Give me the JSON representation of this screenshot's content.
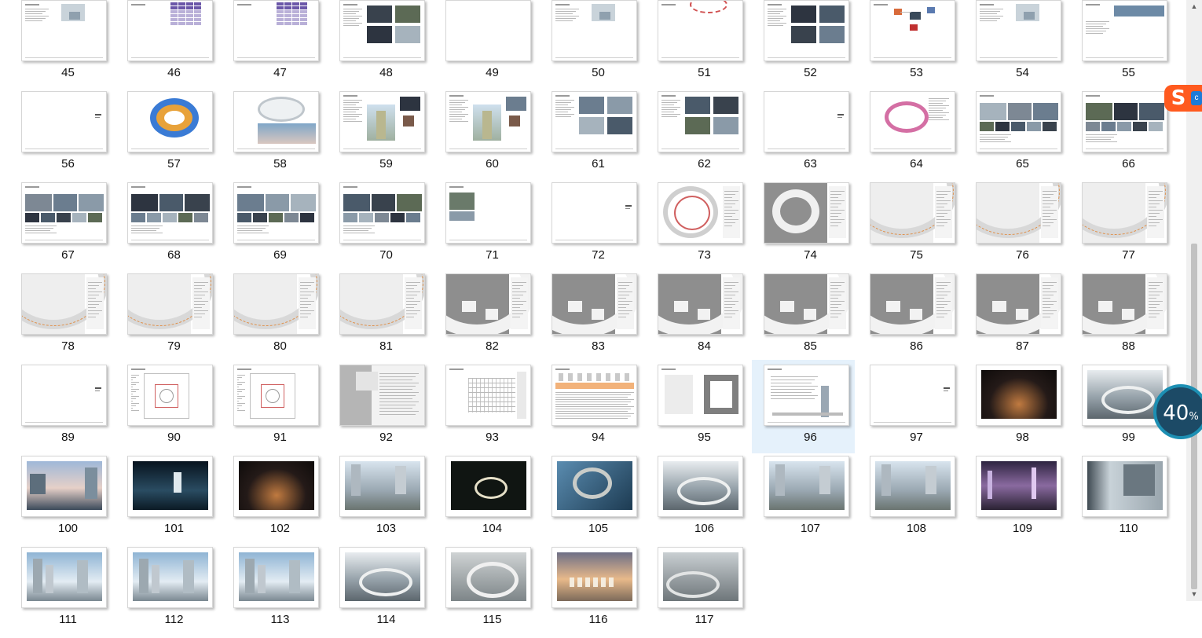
{
  "window": {
    "type": "file-explorer-thumbnail-view"
  },
  "selected_item": "96",
  "items": [
    {
      "label": "45",
      "kind": "doc"
    },
    {
      "label": "46",
      "kind": "doc-table-purple"
    },
    {
      "label": "47",
      "kind": "doc-table-purple"
    },
    {
      "label": "48",
      "kind": "doc-photos"
    },
    {
      "label": "49",
      "kind": "blank"
    },
    {
      "label": "50",
      "kind": "doc"
    },
    {
      "label": "51",
      "kind": "doc-ring"
    },
    {
      "label": "52",
      "kind": "doc-photos"
    },
    {
      "label": "53",
      "kind": "doc-diagram"
    },
    {
      "label": "54",
      "kind": "doc"
    },
    {
      "label": "55",
      "kind": "doc-photo-strip"
    },
    {
      "label": "56",
      "kind": "divider"
    },
    {
      "label": "57",
      "kind": "stadium-color"
    },
    {
      "label": "58",
      "kind": "stadium-photo"
    },
    {
      "label": "59",
      "kind": "tower"
    },
    {
      "label": "60",
      "kind": "tower"
    },
    {
      "label": "61",
      "kind": "doc-photos"
    },
    {
      "label": "62",
      "kind": "doc-photos"
    },
    {
      "label": "63",
      "kind": "divider"
    },
    {
      "label": "64",
      "kind": "stadium-pink"
    },
    {
      "label": "65",
      "kind": "photo-grid"
    },
    {
      "label": "66",
      "kind": "photo-grid"
    },
    {
      "label": "67",
      "kind": "photo-grid"
    },
    {
      "label": "68",
      "kind": "photo-grid"
    },
    {
      "label": "69",
      "kind": "photo-grid"
    },
    {
      "label": "70",
      "kind": "photo-grid"
    },
    {
      "label": "71",
      "kind": "single-photo"
    },
    {
      "label": "72",
      "kind": "divider"
    },
    {
      "label": "73",
      "kind": "plan-ring"
    },
    {
      "label": "74",
      "kind": "plan-ring-gray"
    },
    {
      "label": "75",
      "kind": "plan-light"
    },
    {
      "label": "76",
      "kind": "plan-light"
    },
    {
      "label": "77",
      "kind": "plan-light"
    },
    {
      "label": "78",
      "kind": "plan-light"
    },
    {
      "label": "79",
      "kind": "plan-light"
    },
    {
      "label": "80",
      "kind": "plan-light"
    },
    {
      "label": "81",
      "kind": "plan-light"
    },
    {
      "label": "82",
      "kind": "plan-dark"
    },
    {
      "label": "83",
      "kind": "plan-dark"
    },
    {
      "label": "84",
      "kind": "plan-dark"
    },
    {
      "label": "85",
      "kind": "plan-dark"
    },
    {
      "label": "86",
      "kind": "plan-dark"
    },
    {
      "label": "87",
      "kind": "plan-dark"
    },
    {
      "label": "88",
      "kind": "plan-dark"
    },
    {
      "label": "89",
      "kind": "divider"
    },
    {
      "label": "90",
      "kind": "plan-square"
    },
    {
      "label": "91",
      "kind": "plan-square"
    },
    {
      "label": "92",
      "kind": "plan-gray-section"
    },
    {
      "label": "93",
      "kind": "section-grid"
    },
    {
      "label": "94",
      "kind": "section-orange"
    },
    {
      "label": "95",
      "kind": "section-plans"
    },
    {
      "label": "96",
      "kind": "section-elev"
    },
    {
      "label": "97",
      "kind": "divider"
    },
    {
      "label": "98",
      "kind": "render-night"
    },
    {
      "label": "99",
      "kind": "render-aerial"
    },
    {
      "label": "100",
      "kind": "render-dusk"
    },
    {
      "label": "101",
      "kind": "render-night-blue"
    },
    {
      "label": "102",
      "kind": "render-night"
    },
    {
      "label": "103",
      "kind": "render-day"
    },
    {
      "label": "104",
      "kind": "render-dark-ring"
    },
    {
      "label": "105",
      "kind": "render-blue-ring"
    },
    {
      "label": "106",
      "kind": "render-aerial"
    },
    {
      "label": "107",
      "kind": "render-day"
    },
    {
      "label": "108",
      "kind": "render-day"
    },
    {
      "label": "109",
      "kind": "render-purple"
    },
    {
      "label": "110",
      "kind": "render-interior"
    },
    {
      "label": "111",
      "kind": "render-sky"
    },
    {
      "label": "112",
      "kind": "render-sky"
    },
    {
      "label": "113",
      "kind": "render-sky"
    },
    {
      "label": "114",
      "kind": "render-aerial"
    },
    {
      "label": "115",
      "kind": "render-aerial-gray"
    },
    {
      "label": "116",
      "kind": "render-sunset"
    },
    {
      "label": "117",
      "kind": "render-gray"
    }
  ],
  "progress_widget": {
    "value": "40",
    "unit": "%"
  },
  "ime_badge": {
    "icon": "sogou-s-icon",
    "letter": "S",
    "side_letter": "c"
  },
  "scrollbar": {
    "up_icon": "▲",
    "down_icon": "▼"
  },
  "colors": {
    "selection": "#e5f1fb",
    "ime_orange": "#ff5a1f",
    "widget_teal": "#1c8fb3",
    "widget_dark": "#1c4a66"
  }
}
